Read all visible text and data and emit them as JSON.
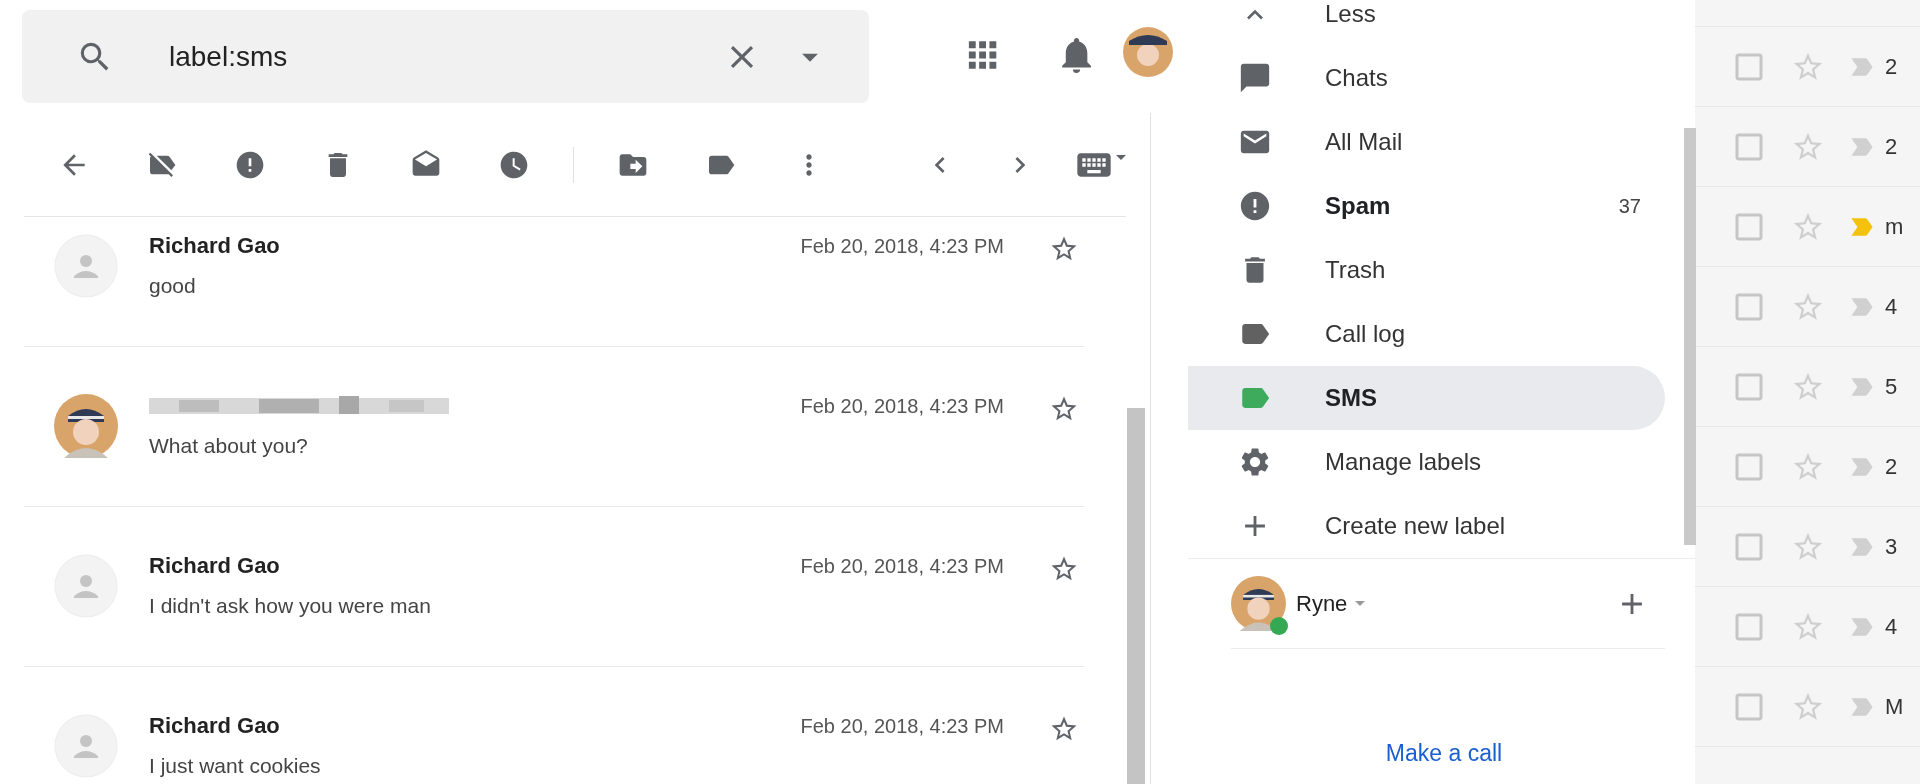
{
  "search": {
    "value": "label:sms"
  },
  "messages": [
    {
      "sender": "Richard Gao",
      "sender_hidden": false,
      "photo": false,
      "snippet": "good",
      "time": "Feb 20, 2018, 4:23 PM",
      "starred": false
    },
    {
      "sender_hidden": true,
      "photo": true,
      "snippet": "What about you?",
      "time": "Feb 20, 2018, 4:23 PM",
      "starred": false
    },
    {
      "sender": "Richard Gao",
      "sender_hidden": false,
      "photo": false,
      "snippet": "I didn't ask how you were man",
      "time": "Feb 20, 2018, 4:23 PM",
      "starred": false
    },
    {
      "sender": "Richard Gao",
      "sender_hidden": false,
      "photo": false,
      "snippet": "I just want cookies",
      "time": "Feb 20, 2018, 4:23 PM",
      "starred": false
    }
  ],
  "menu": {
    "items": [
      {
        "kind": "less",
        "label": "Less",
        "selected": false,
        "bold": false
      },
      {
        "kind": "chats",
        "label": "Chats",
        "selected": false,
        "bold": false
      },
      {
        "kind": "all_mail",
        "label": "All Mail",
        "selected": false,
        "bold": false
      },
      {
        "kind": "spam",
        "label": "Spam",
        "count": "37",
        "selected": false,
        "bold": true
      },
      {
        "kind": "trash",
        "label": "Trash",
        "selected": false,
        "bold": false
      },
      {
        "kind": "label",
        "label": "Call log",
        "color": "#616161",
        "selected": false,
        "bold": false
      },
      {
        "kind": "label",
        "label": "SMS",
        "color": "#3daa5c",
        "selected": true,
        "bold": true
      },
      {
        "kind": "manage",
        "label": "Manage labels",
        "selected": false,
        "bold": false
      },
      {
        "kind": "create",
        "label": "Create new label",
        "selected": false,
        "bold": false
      }
    ]
  },
  "account": {
    "name": "Ryne",
    "online": true
  },
  "call_link": "Make a call",
  "inbox_rows": [
    {
      "checked": false,
      "starred": false,
      "important": false,
      "text": "2"
    },
    {
      "checked": false,
      "starred": false,
      "important": false,
      "text": "2"
    },
    {
      "checked": false,
      "starred": false,
      "important": true,
      "text": "m"
    },
    {
      "checked": false,
      "starred": false,
      "important": false,
      "text": "4"
    },
    {
      "checked": false,
      "starred": false,
      "important": false,
      "text": "5"
    },
    {
      "checked": false,
      "starred": false,
      "important": false,
      "text": "2"
    },
    {
      "checked": false,
      "starred": false,
      "important": false,
      "text": "3"
    },
    {
      "checked": false,
      "starred": false,
      "important": false,
      "text": "4"
    },
    {
      "checked": false,
      "starred": false,
      "important": false,
      "text": "M"
    }
  ]
}
